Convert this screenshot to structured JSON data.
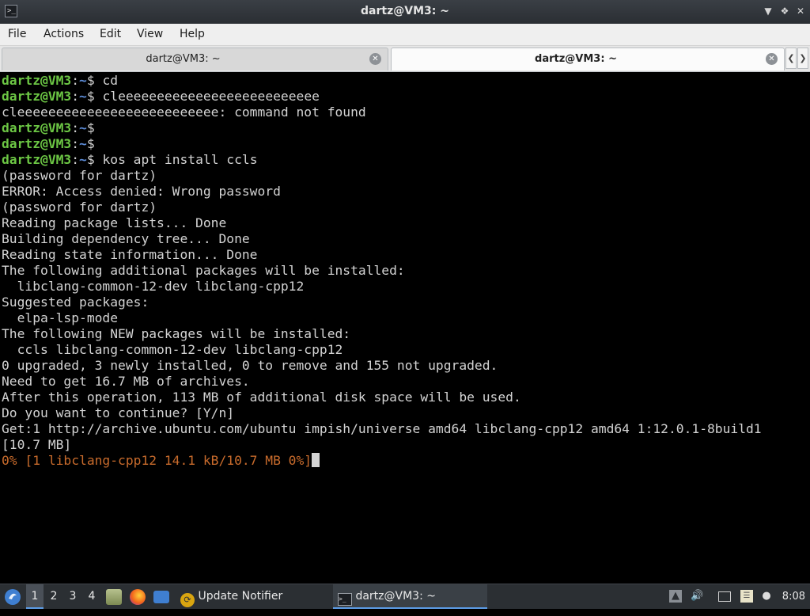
{
  "window": {
    "title": "dartz@VM3: ~",
    "app_icon": ">_",
    "buttons": [
      "minimize-icon",
      "maximize-icon",
      "close-icon"
    ]
  },
  "menu": [
    "File",
    "Actions",
    "Edit",
    "View",
    "Help"
  ],
  "tabs": [
    {
      "label": "dartz@VM3: ~",
      "active": false
    },
    {
      "label": "dartz@VM3: ~",
      "active": true
    }
  ],
  "terminal": {
    "prompt_user": "dartz@VM3",
    "prompt_path": "~",
    "lines": [
      {
        "prompt": true,
        "text": "cd"
      },
      {
        "prompt": true,
        "text": "cleeeeeeeeeeeeeeeeeeeeeeeeee"
      },
      {
        "prompt": false,
        "text": "cleeeeeeeeeeeeeeeeeeeeeeeeee: command not found"
      },
      {
        "prompt": true,
        "text": ""
      },
      {
        "prompt": true,
        "text": ""
      },
      {
        "prompt": true,
        "text": "kos apt install ccls"
      },
      {
        "prompt": false,
        "text": "(password for dartz)"
      },
      {
        "prompt": false,
        "text": "ERROR: Access denied: Wrong password"
      },
      {
        "prompt": false,
        "text": "(password for dartz)"
      },
      {
        "prompt": false,
        "text": "Reading package lists... Done"
      },
      {
        "prompt": false,
        "text": "Building dependency tree... Done"
      },
      {
        "prompt": false,
        "text": "Reading state information... Done"
      },
      {
        "prompt": false,
        "text": "The following additional packages will be installed:"
      },
      {
        "prompt": false,
        "text": "  libclang-common-12-dev libclang-cpp12"
      },
      {
        "prompt": false,
        "text": "Suggested packages:"
      },
      {
        "prompt": false,
        "text": "  elpa-lsp-mode"
      },
      {
        "prompt": false,
        "text": "The following NEW packages will be installed:"
      },
      {
        "prompt": false,
        "text": "  ccls libclang-common-12-dev libclang-cpp12"
      },
      {
        "prompt": false,
        "text": "0 upgraded, 3 newly installed, 0 to remove and 155 not upgraded."
      },
      {
        "prompt": false,
        "text": "Need to get 16.7 MB of archives."
      },
      {
        "prompt": false,
        "text": "After this operation, 113 MB of additional disk space will be used."
      },
      {
        "prompt": false,
        "text": "Do you want to continue? [Y/n]"
      },
      {
        "prompt": false,
        "text": "Get:1 http://archive.ubuntu.com/ubuntu impish/universe amd64 libclang-cpp12 amd64 1:12.0.1-8build1"
      },
      {
        "prompt": false,
        "text": "[10.7 MB]"
      },
      {
        "prompt": false,
        "text": "0% [1 libclang-cpp12 14.1 kB/10.7 MB 0%]",
        "progress": true
      }
    ]
  },
  "taskbar": {
    "desktops": [
      "1",
      "2",
      "3",
      "4"
    ],
    "active_desktop": "1",
    "tasks": [
      {
        "label": "Update Notifier",
        "icon": "update-notifier-icon"
      },
      {
        "label": "dartz@VM3: ~",
        "icon": "terminal-icon",
        "active": true
      }
    ],
    "clock": "8:08"
  }
}
